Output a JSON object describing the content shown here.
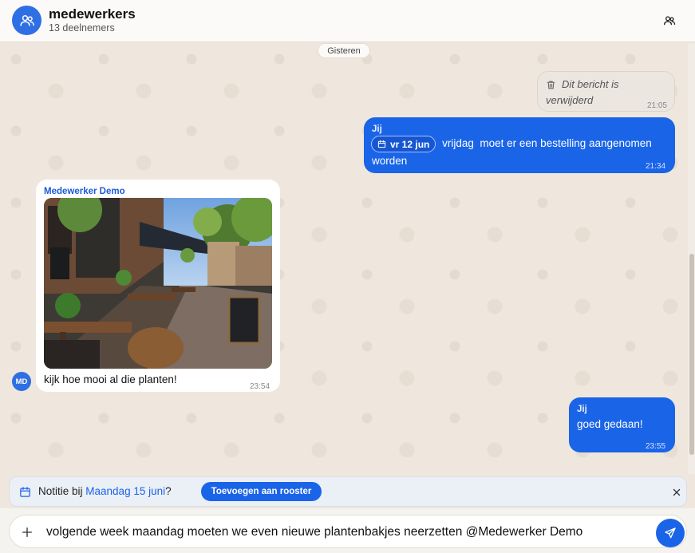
{
  "header": {
    "title": "medewerkers",
    "subtitle": "13 deelnemers",
    "avatar_icon": "group-icon",
    "action_icon": "participants-icon"
  },
  "chat": {
    "date_separator": "Gisteren",
    "messages": [
      {
        "type": "deleted",
        "text": "Dit bericht is verwijderd",
        "time": "21:05"
      },
      {
        "type": "outgoing",
        "sender": "Jij",
        "chip": "vr 12 jun",
        "text_after_chip": "vrijdag  moet er een bestelling aangenomen",
        "text_line2": "worden",
        "time": "21:34"
      },
      {
        "type": "incoming",
        "sender": "Medewerker Demo",
        "avatar_initials": "MD",
        "text": "kijk hoe mooi al die planten!",
        "time": "23:54"
      },
      {
        "type": "outgoing",
        "sender": "Jij",
        "text": "goed gedaan!",
        "time": "23:55"
      }
    ]
  },
  "suggestion": {
    "prefix": "Notitie bij ",
    "date": "Maandag 15 juni",
    "suffix": "?",
    "button": "Toevoegen aan rooster"
  },
  "composer": {
    "value": "volgende week maandag moeten we even nieuwe plantenbakjes neerzetten @Medewerker Demo"
  },
  "colors": {
    "accent": "#1a64e8",
    "background": "#efe7dd"
  }
}
